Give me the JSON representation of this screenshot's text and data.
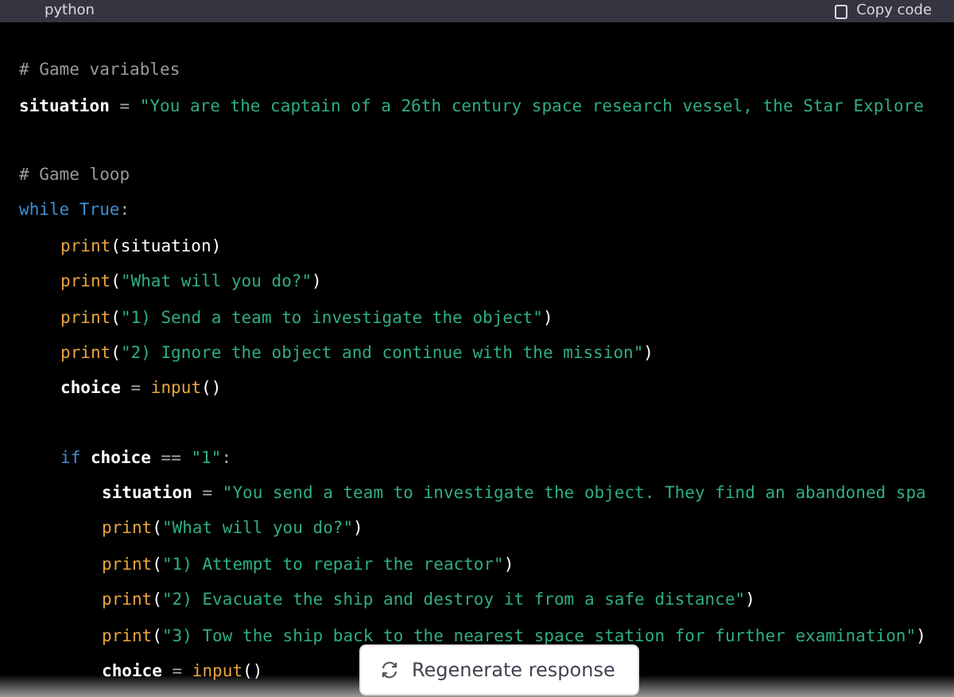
{
  "header": {
    "language": "python",
    "copy_label": "Copy code"
  },
  "code": [
    {
      "kind": "code",
      "tokens": [
        {
          "kind": "comment",
          "text": "# Game variables"
        }
      ]
    },
    {
      "kind": "code",
      "tokens": [
        {
          "kind": "name",
          "text": "situation"
        },
        {
          "kind": "op",
          "text": " = "
        },
        {
          "kind": "string",
          "text": "\"You are the captain of a 26th century space research vessel, the Star Explore"
        }
      ]
    },
    {
      "kind": "blank"
    },
    {
      "kind": "code",
      "tokens": [
        {
          "kind": "comment",
          "text": "# Game loop"
        }
      ]
    },
    {
      "kind": "code",
      "tokens": [
        {
          "kind": "keyword",
          "text": "while True"
        },
        {
          "kind": "op",
          "text": ":"
        }
      ],
      "children": [
        {
          "kind": "code",
          "tokens": [
            {
              "kind": "builtin",
              "text": "print"
            },
            {
              "kind": "punct",
              "text": "(situation)"
            }
          ]
        },
        {
          "kind": "code",
          "tokens": [
            {
              "kind": "builtin",
              "text": "print"
            },
            {
              "kind": "punct",
              "text": "("
            },
            {
              "kind": "string",
              "text": "\"What will you do?\""
            },
            {
              "kind": "punct",
              "text": ")"
            }
          ]
        },
        {
          "kind": "code",
          "tokens": [
            {
              "kind": "builtin",
              "text": "print"
            },
            {
              "kind": "punct",
              "text": "("
            },
            {
              "kind": "string",
              "text": "\"1) Send a team to investigate the object\""
            },
            {
              "kind": "punct",
              "text": ")"
            }
          ]
        },
        {
          "kind": "code",
          "tokens": [
            {
              "kind": "builtin",
              "text": "print"
            },
            {
              "kind": "punct",
              "text": "("
            },
            {
              "kind": "string",
              "text": "\"2) Ignore the object and continue with the mission\""
            },
            {
              "kind": "punct",
              "text": ")"
            }
          ]
        },
        {
          "kind": "code",
          "tokens": [
            {
              "kind": "name",
              "text": "choice"
            },
            {
              "kind": "op",
              "text": " = "
            },
            {
              "kind": "builtin",
              "text": "input"
            },
            {
              "kind": "punct",
              "text": "()"
            }
          ]
        },
        {
          "kind": "blank"
        },
        {
          "kind": "code",
          "tokens": [
            {
              "kind": "keyword",
              "text": "if"
            },
            {
              "kind": "name",
              "text": " choice"
            },
            {
              "kind": "op",
              "text": " == "
            },
            {
              "kind": "string",
              "text": "\"1\""
            },
            {
              "kind": "op",
              "text": ":"
            }
          ],
          "children": [
            {
              "kind": "code",
              "tokens": [
                {
                  "kind": "name",
                  "text": "situation"
                },
                {
                  "kind": "op",
                  "text": " = "
                },
                {
                  "kind": "string",
                  "text": "\"You send a team to investigate the object. They find an abandoned spa"
                }
              ]
            },
            {
              "kind": "code",
              "tokens": [
                {
                  "kind": "builtin",
                  "text": "print"
                },
                {
                  "kind": "punct",
                  "text": "("
                },
                {
                  "kind": "string",
                  "text": "\"What will you do?\""
                },
                {
                  "kind": "punct",
                  "text": ")"
                }
              ]
            },
            {
              "kind": "code",
              "tokens": [
                {
                  "kind": "builtin",
                  "text": "print"
                },
                {
                  "kind": "punct",
                  "text": "("
                },
                {
                  "kind": "string",
                  "text": "\"1) Attempt to repair the reactor\""
                },
                {
                  "kind": "punct",
                  "text": ")"
                }
              ]
            },
            {
              "kind": "code",
              "tokens": [
                {
                  "kind": "builtin",
                  "text": "print"
                },
                {
                  "kind": "punct",
                  "text": "("
                },
                {
                  "kind": "string",
                  "text": "\"2) Evacuate the ship and destroy it from a safe distance\""
                },
                {
                  "kind": "punct",
                  "text": ")"
                }
              ]
            },
            {
              "kind": "code",
              "tokens": [
                {
                  "kind": "builtin",
                  "text": "print"
                },
                {
                  "kind": "punct",
                  "text": "("
                },
                {
                  "kind": "string",
                  "text": "\"3) Tow the ship back to the nearest space station for further examination\""
                },
                {
                  "kind": "punct",
                  "text": ")"
                }
              ]
            },
            {
              "kind": "code",
              "tokens": [
                {
                  "kind": "name",
                  "text": "choice"
                },
                {
                  "kind": "op",
                  "text": " = "
                },
                {
                  "kind": "builtin",
                  "text": "input"
                },
                {
                  "kind": "punct",
                  "text": "()"
                }
              ]
            }
          ]
        }
      ]
    }
  ],
  "regenerate_button": {
    "label": "Regenerate response"
  }
}
